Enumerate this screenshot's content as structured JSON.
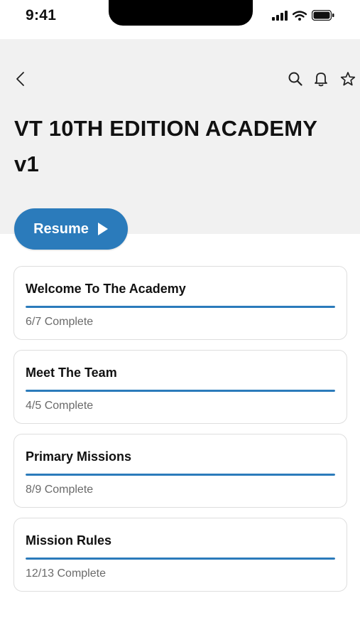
{
  "status_bar": {
    "time": "9:41"
  },
  "header": {
    "title": "VT 10TH EDITION ACADEMY v1"
  },
  "resume": {
    "label": "Resume"
  },
  "modules": [
    {
      "title": "Welcome To The Academy",
      "status": "6/7 Complete",
      "progress": 1.0
    },
    {
      "title": "Meet The Team",
      "status": "4/5 Complete",
      "progress": 1.0
    },
    {
      "title": "Primary Missions",
      "status": "8/9 Complete",
      "progress": 1.0
    },
    {
      "title": "Mission Rules",
      "status": "12/13 Complete",
      "progress": 1.0
    }
  ],
  "colors": {
    "accent": "#2b7bbb",
    "header_bg": "#f1f1f1"
  },
  "icons": [
    "back-icon",
    "search-icon",
    "bell-icon",
    "star-icon",
    "play-icon"
  ]
}
